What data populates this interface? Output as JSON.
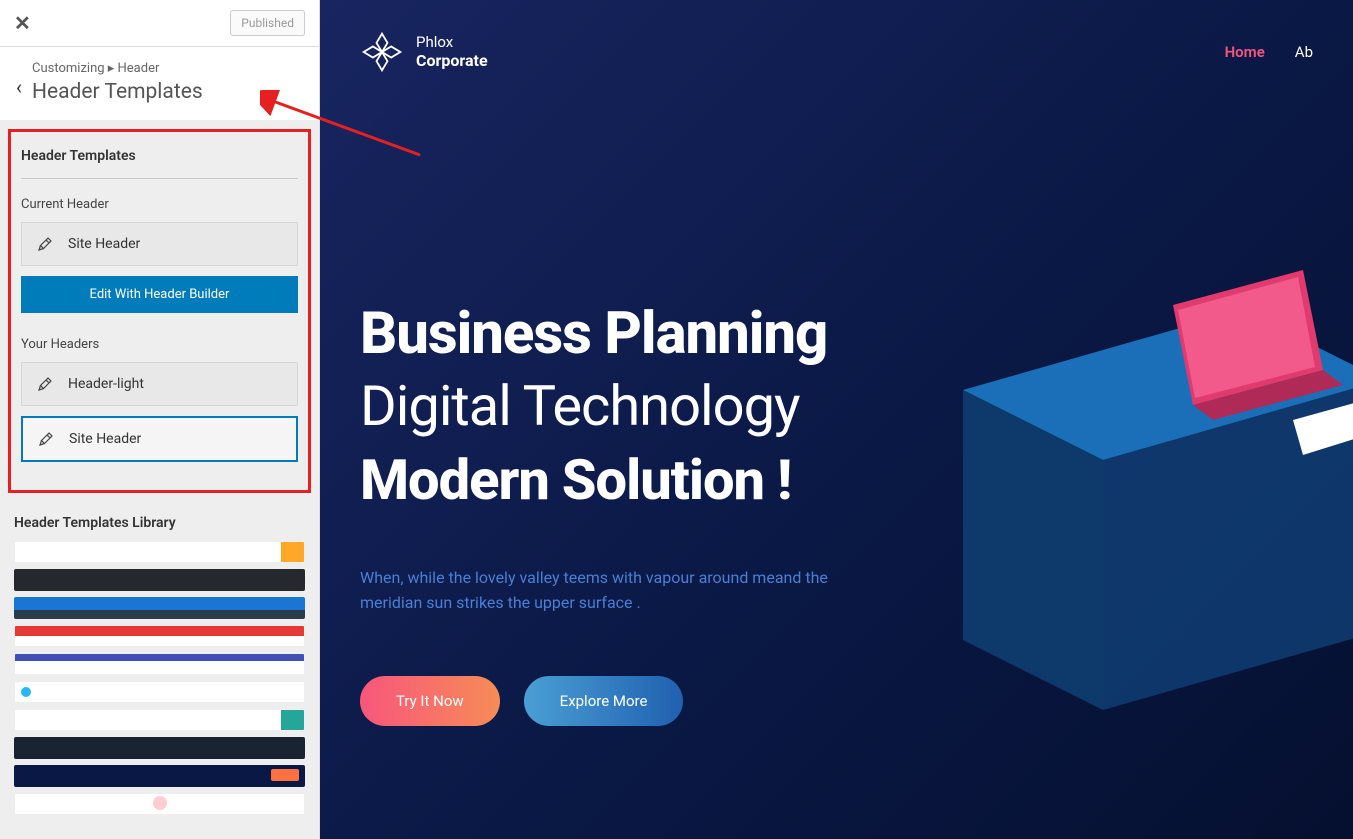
{
  "topbar": {
    "publish_label": "Published"
  },
  "breadcrumb": {
    "path": "Customizing ▸ Header",
    "title": "Header Templates"
  },
  "panel": {
    "section_heading": "Header Templates",
    "current_label": "Current Header",
    "current_item": "Site Header",
    "edit_button": "Edit With Header Builder",
    "your_label": "Your Headers",
    "your_items": [
      "Header-light",
      "Site Header"
    ],
    "library_heading": "Header Templates Library"
  },
  "site": {
    "logo_top": "Phlox",
    "logo_bottom": "Corporate",
    "nav": [
      {
        "label": "Home",
        "active": true
      },
      {
        "label": "Ab",
        "active": false
      }
    ]
  },
  "hero": {
    "title": "Business Planning",
    "line2": "Digital Technology",
    "line3": "Modern Solution !",
    "desc": "When, while the lovely valley teems with vapour around meand the meridian sun strikes the upper surface .",
    "btn1": "Try It Now",
    "btn2": "Explore More"
  }
}
